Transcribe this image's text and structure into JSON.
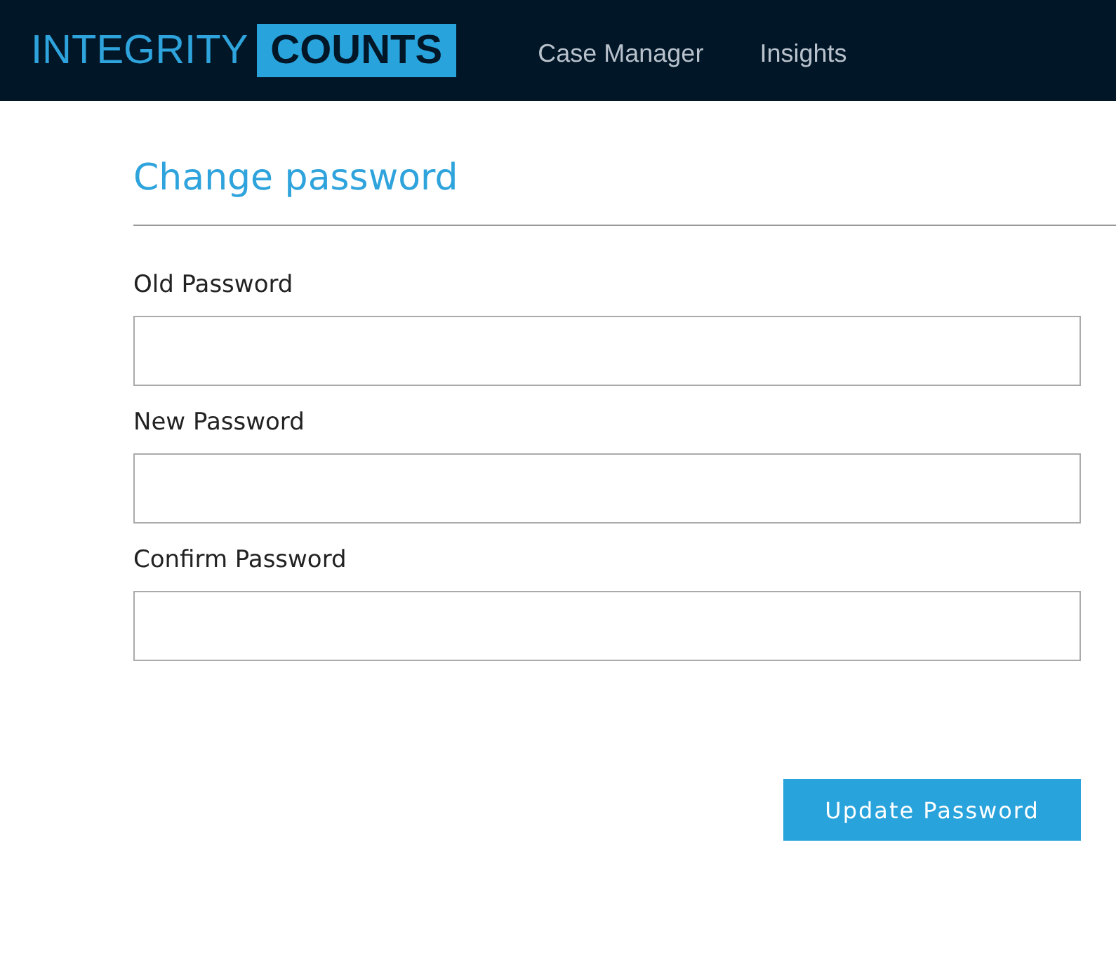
{
  "header": {
    "logo": {
      "text": "INTEGRITY",
      "highlight": "COUNTS"
    },
    "nav": [
      {
        "label": "Case Manager"
      },
      {
        "label": "Insights"
      }
    ]
  },
  "form": {
    "title": "Change password",
    "fields": [
      {
        "label": "Old Password"
      },
      {
        "label": "New Password"
      },
      {
        "label": "Confirm Password"
      }
    ],
    "submit": "Update Password"
  }
}
